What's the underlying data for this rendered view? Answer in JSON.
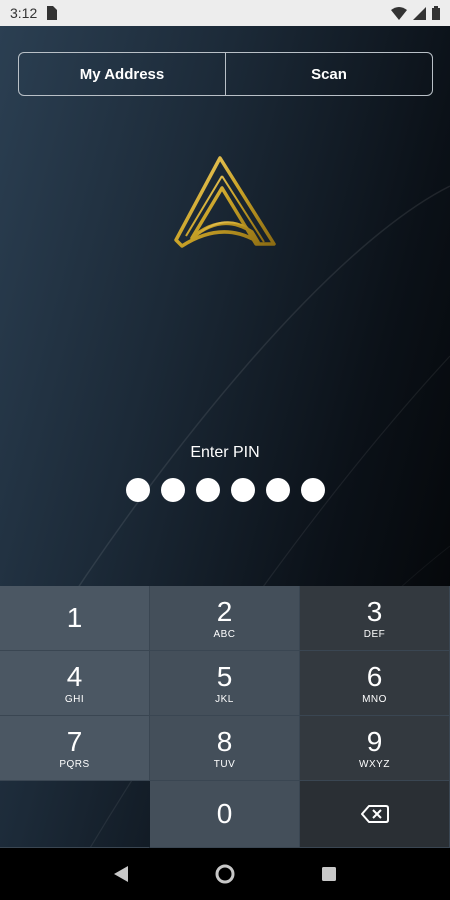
{
  "status_bar": {
    "time": "3:12"
  },
  "segmented": {
    "my_address": "My Address",
    "scan": "Scan"
  },
  "pin": {
    "label": "Enter PIN",
    "dots": 6
  },
  "keypad": {
    "k1": {
      "num": "1",
      "letters": ""
    },
    "k2": {
      "num": "2",
      "letters": "ABC"
    },
    "k3": {
      "num": "3",
      "letters": "DEF"
    },
    "k4": {
      "num": "4",
      "letters": "GHI"
    },
    "k5": {
      "num": "5",
      "letters": "JKL"
    },
    "k6": {
      "num": "6",
      "letters": "MNO"
    },
    "k7": {
      "num": "7",
      "letters": "PQRS"
    },
    "k8": {
      "num": "8",
      "letters": "TUV"
    },
    "k9": {
      "num": "9",
      "letters": "WXYZ"
    },
    "k0": {
      "num": "0",
      "letters": ""
    }
  },
  "colors": {
    "logo_gold": "#c9a227",
    "background_dark": "#0b1118",
    "keypad_light": "#4b5763"
  },
  "icons": [
    "sim-card-icon",
    "wifi-icon",
    "signal-icon",
    "battery-icon",
    "backspace-icon",
    "back-nav-icon",
    "home-nav-icon",
    "recents-nav-icon"
  ]
}
